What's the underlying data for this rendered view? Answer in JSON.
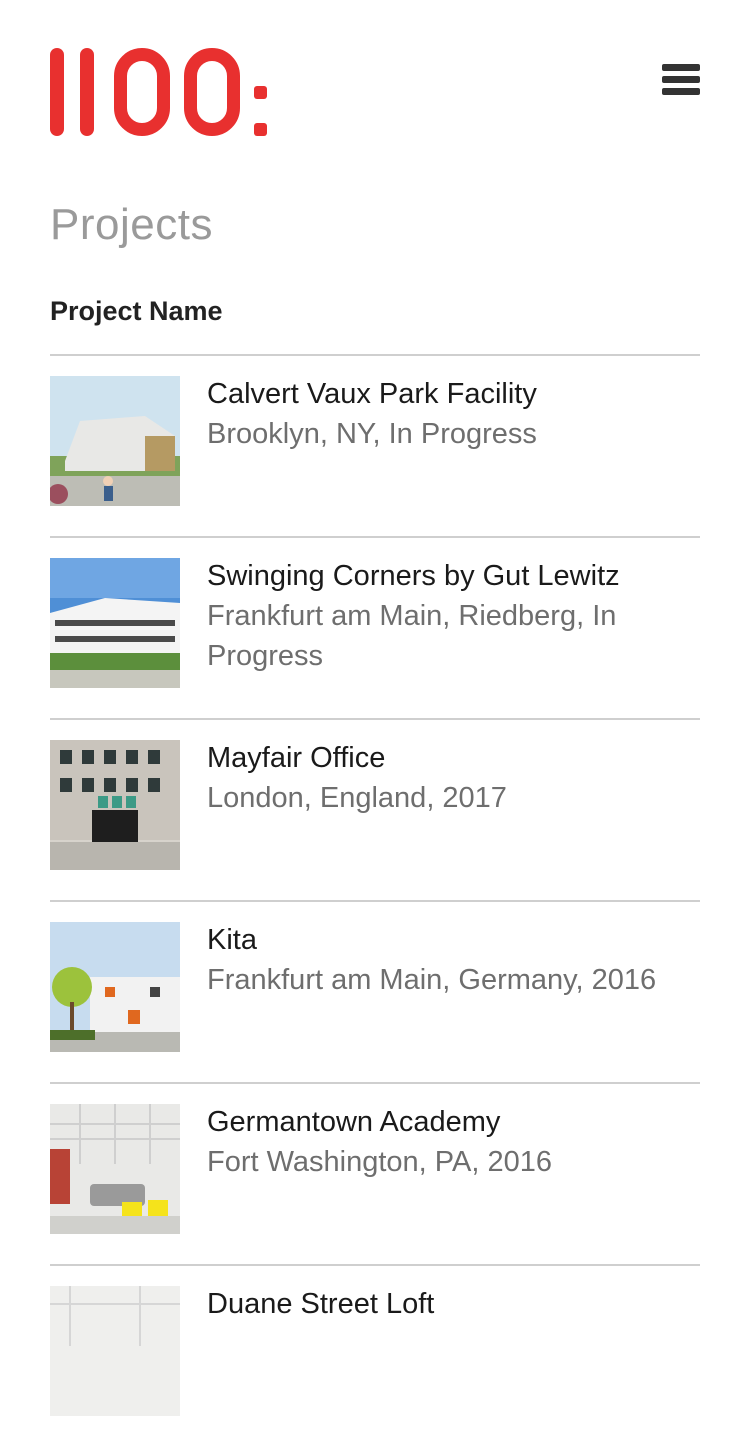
{
  "brand": {
    "logo_text": "1100:",
    "accent_color": "#e8302f"
  },
  "header": {
    "menu_icon": "hamburger-menu-icon"
  },
  "page": {
    "title": "Projects",
    "column_header": "Project Name"
  },
  "projects": [
    {
      "name": "Calvert Vaux Park Facility",
      "meta": "Brooklyn, NY, In Progress"
    },
    {
      "name": "Swinging Corners by Gut Lewitz",
      "meta": "Frankfurt am Main, Riedberg, In Progress"
    },
    {
      "name": "Mayfair Office",
      "meta": "London, England, 2017"
    },
    {
      "name": "Kita",
      "meta": "Frankfurt am Main, Germany, 2016"
    },
    {
      "name": "Germantown Academy",
      "meta": "Fort Washington, PA, 2016"
    },
    {
      "name": "Duane Street Loft",
      "meta": ""
    }
  ]
}
